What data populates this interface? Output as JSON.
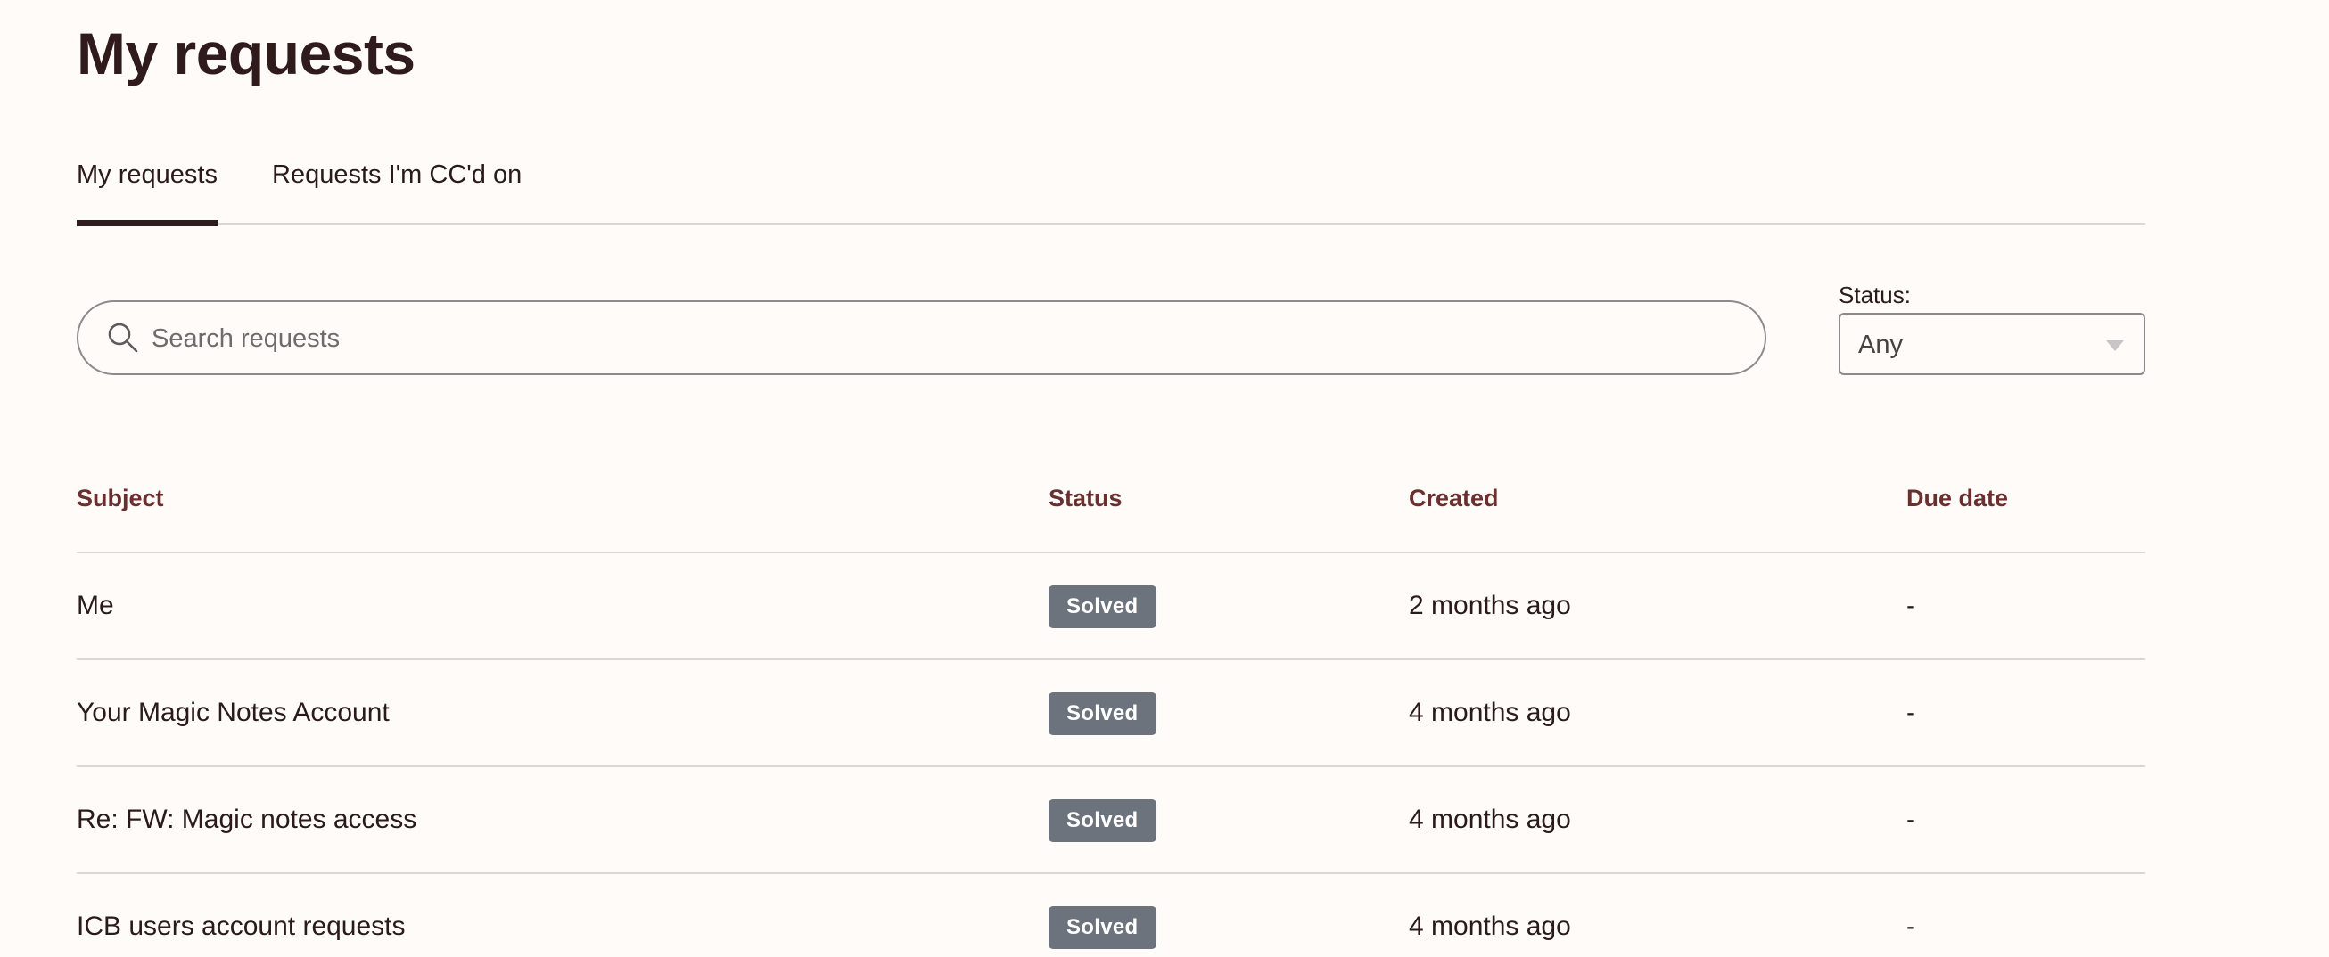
{
  "page": {
    "title": "My requests"
  },
  "tabs": [
    {
      "label": "My requests",
      "active": true
    },
    {
      "label": "Requests I'm CC'd on",
      "active": false
    }
  ],
  "search": {
    "placeholder": "Search requests",
    "value": "",
    "icon": "search-icon"
  },
  "status_filter": {
    "label": "Status:",
    "selected": "Any"
  },
  "table": {
    "headers": {
      "subject": "Subject",
      "status": "Status",
      "created": "Created",
      "due_date": "Due date"
    },
    "rows": [
      {
        "subject": "Me",
        "status": "Solved",
        "created": "2 months ago",
        "due_date": "-"
      },
      {
        "subject": "Your Magic Notes Account",
        "status": "Solved",
        "created": "4 months ago",
        "due_date": "-"
      },
      {
        "subject": "Re: FW: Magic notes access",
        "status": "Solved",
        "created": "4 months ago",
        "due_date": "-"
      },
      {
        "subject": "ICB users account requests",
        "status": "Solved",
        "created": "4 months ago",
        "due_date": "-"
      }
    ]
  },
  "colors": {
    "background": "#fefbf8",
    "title_text": "#2f1b1b",
    "header_text": "#6b2f2f",
    "status_badge_solved": "#6c737c",
    "divider": "#dcd7d3"
  }
}
